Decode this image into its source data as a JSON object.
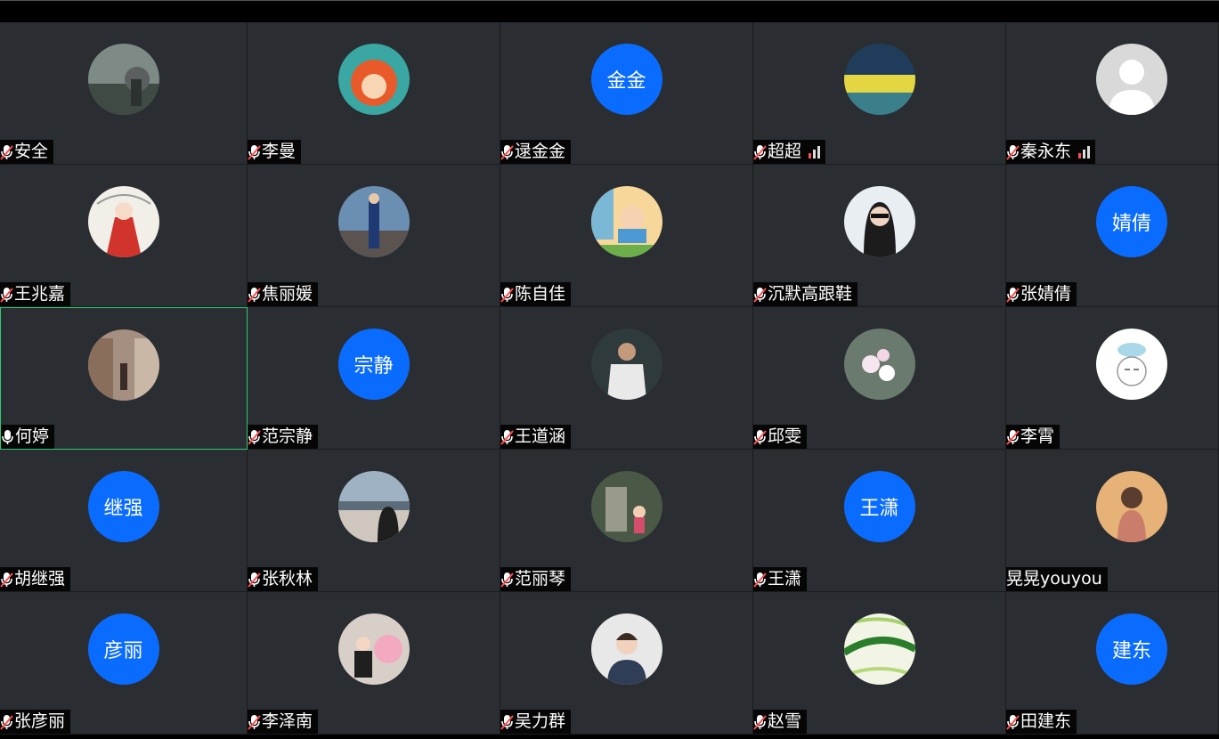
{
  "participants": [
    {
      "name": "安全",
      "avatar_type": "photo",
      "avatar_icon": "garden-photo",
      "mic": "muted",
      "signal": false
    },
    {
      "name": "李曼",
      "avatar_type": "photo",
      "avatar_icon": "cartoon-girl-photo",
      "mic": "muted",
      "signal": false
    },
    {
      "name": "逯金金",
      "avatar_type": "text",
      "avatar_text": "金金",
      "mic": "muted",
      "signal": false
    },
    {
      "name": "超超",
      "avatar_type": "photo",
      "avatar_icon": "flower-field-photo",
      "mic": "muted",
      "signal": true
    },
    {
      "name": "秦永东",
      "avatar_type": "photo",
      "avatar_icon": "default-user-silhouette",
      "mic": "muted",
      "signal": true
    },
    {
      "name": "王兆嘉",
      "avatar_type": "photo",
      "avatar_icon": "illustrated-girl-photo",
      "mic": "muted",
      "signal": false
    },
    {
      "name": "焦丽媛",
      "avatar_type": "photo",
      "avatar_icon": "beach-woman-photo",
      "mic": "muted",
      "signal": false
    },
    {
      "name": "陈自佳",
      "avatar_type": "photo",
      "avatar_icon": "cartoon-boy-reading-photo",
      "mic": "muted",
      "signal": false
    },
    {
      "name": "沉默高跟鞋",
      "avatar_type": "photo",
      "avatar_icon": "woman-sunglasses-photo",
      "mic": "muted",
      "signal": false
    },
    {
      "name": "张婧倩",
      "avatar_type": "text",
      "avatar_text": "婧倩",
      "mic": "muted",
      "signal": false
    },
    {
      "name": "何婷",
      "avatar_type": "photo",
      "avatar_icon": "street-woman-photo",
      "mic": "on",
      "signal": false,
      "active": true
    },
    {
      "name": "范宗静",
      "avatar_type": "text",
      "avatar_text": "宗静",
      "mic": "muted",
      "signal": false
    },
    {
      "name": "王道涵",
      "avatar_type": "photo",
      "avatar_icon": "man-tshirt-photo",
      "mic": "muted",
      "signal": false
    },
    {
      "name": "邱雯",
      "avatar_type": "photo",
      "avatar_icon": "blossom-photo",
      "mic": "muted",
      "signal": false
    },
    {
      "name": "李霄",
      "avatar_type": "photo",
      "avatar_icon": "cartoon-face-photo",
      "mic": "muted",
      "signal": false
    },
    {
      "name": "胡继强",
      "avatar_type": "text",
      "avatar_text": "继强",
      "mic": "muted",
      "signal": false
    },
    {
      "name": "张秋林",
      "avatar_type": "photo",
      "avatar_icon": "lakeside-woman-photo",
      "mic": "muted",
      "signal": false
    },
    {
      "name": "范丽琴",
      "avatar_type": "photo",
      "avatar_icon": "child-statue-photo",
      "mic": "muted",
      "signal": false
    },
    {
      "name": "王潇",
      "avatar_type": "text",
      "avatar_text": "王潇",
      "mic": "muted",
      "signal": false
    },
    {
      "name": "晃晃youyou",
      "avatar_type": "photo",
      "avatar_icon": "sunset-woman-photo",
      "mic": "none",
      "signal": false
    },
    {
      "name": "张彦丽",
      "avatar_type": "text",
      "avatar_text": "彦丽",
      "mic": "muted",
      "signal": false
    },
    {
      "name": "李泽南",
      "avatar_type": "photo",
      "avatar_icon": "girl-pig-toy-photo",
      "mic": "muted",
      "signal": false
    },
    {
      "name": "吴力群",
      "avatar_type": "photo",
      "avatar_icon": "woman-portrait-photo",
      "mic": "muted",
      "signal": false
    },
    {
      "name": "赵雪",
      "avatar_type": "photo",
      "avatar_icon": "green-leaf-photo",
      "mic": "muted",
      "signal": false
    },
    {
      "name": "田建东",
      "avatar_type": "text",
      "avatar_text": "建东",
      "mic": "muted",
      "signal": false
    }
  ],
  "colors": {
    "tile_bg": "#2a2d31",
    "avatar_blue": "#0a6cff",
    "active_border": "#2ecc71",
    "muted_slash": "#ff4d4f"
  }
}
